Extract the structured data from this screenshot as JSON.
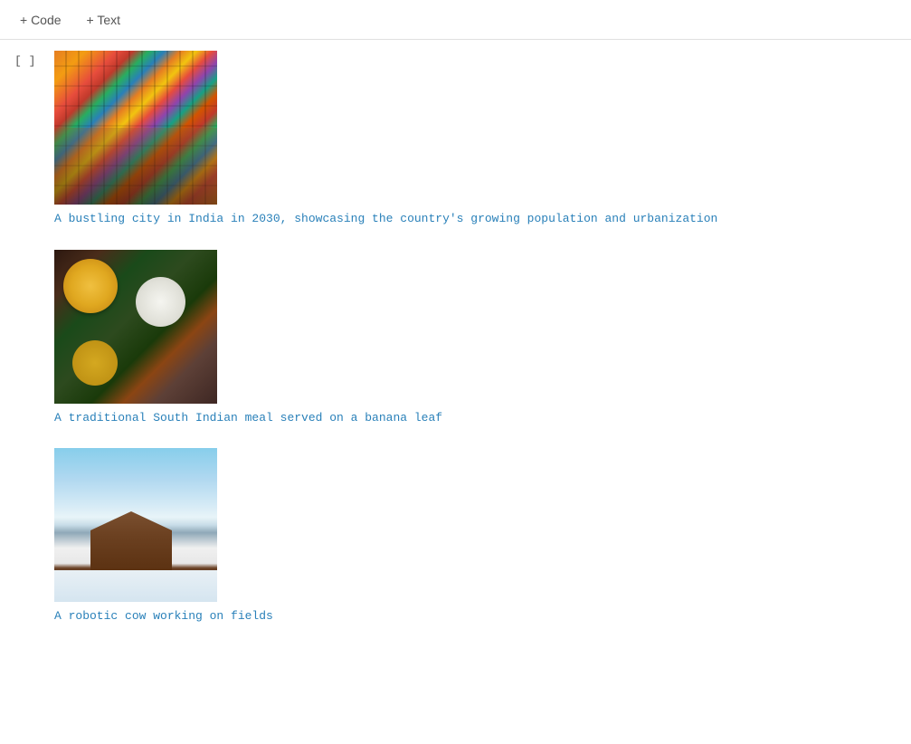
{
  "toolbar": {
    "add_code_label": "+ Code",
    "add_text_label": "+ Text"
  },
  "cell": {
    "bracket": "[ ]",
    "items": [
      {
        "image_alt": "A bustling city in India in 2030",
        "image_type": "india-city",
        "caption": "A bustling city in India in 2030, showcasing the country's growing population and urbanization"
      },
      {
        "image_alt": "A traditional South Indian meal served on a banana leaf",
        "image_type": "food",
        "caption": "A traditional South Indian meal served on a banana leaf"
      },
      {
        "image_alt": "A robotic cow working on fields",
        "image_type": "snow",
        "caption": "A robotic cow working on fields"
      }
    ]
  }
}
